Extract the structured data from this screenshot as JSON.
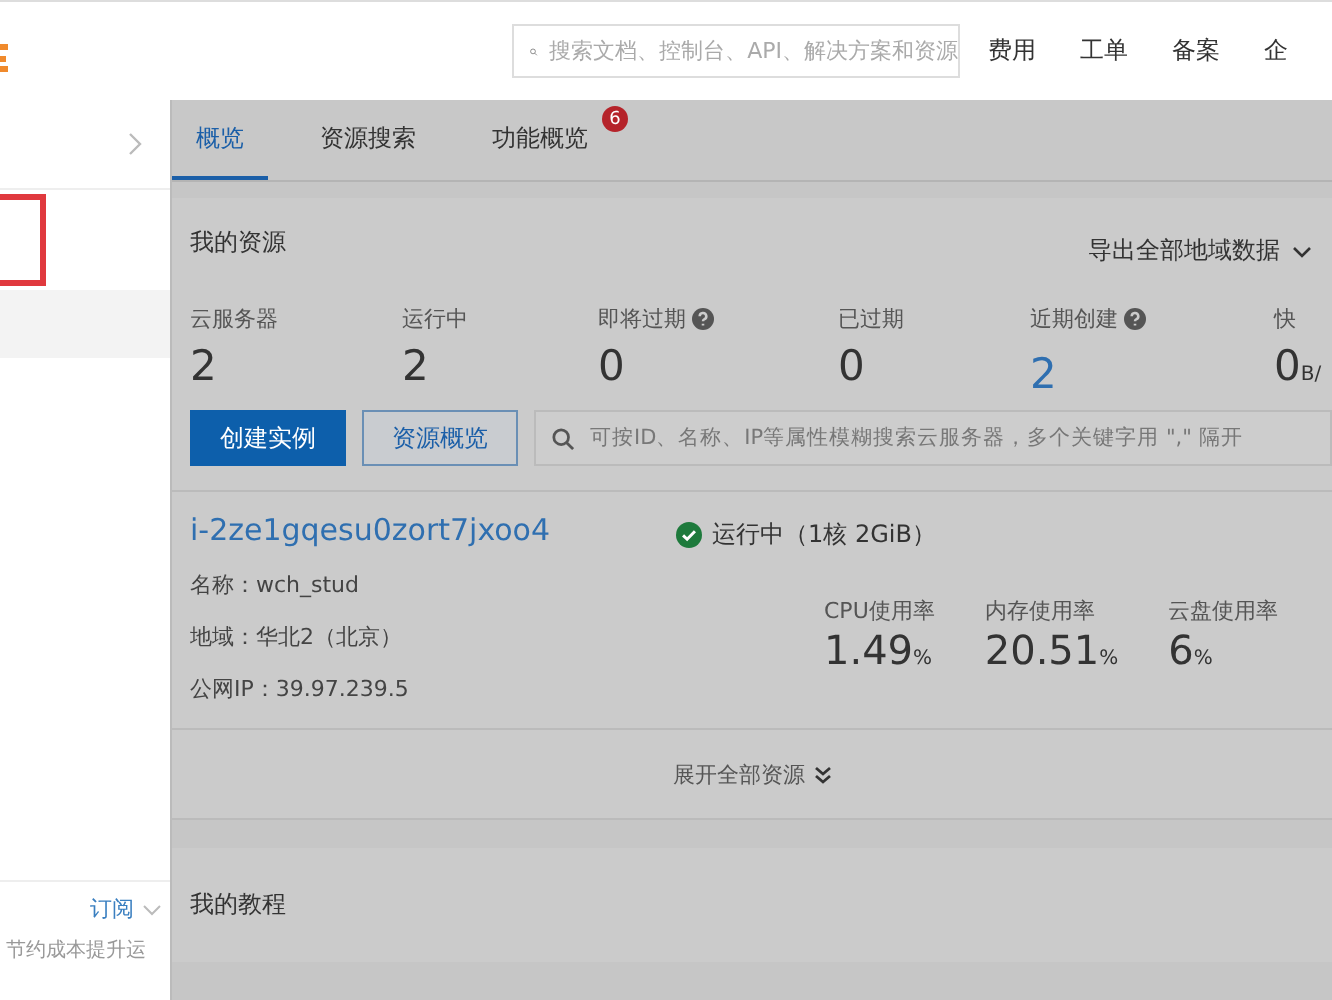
{
  "header": {
    "search": {
      "placeholder": "搜索文档、控制台、API、解决方案和资源"
    },
    "nav": [
      "费用",
      "工单",
      "备案",
      "企"
    ]
  },
  "sidebar": {
    "footer_link": "订阅",
    "footer_text": "节约成本提升运"
  },
  "tabs": [
    {
      "label": "概览",
      "selected": true
    },
    {
      "label": "资源搜索",
      "selected": false
    },
    {
      "label": "功能概览",
      "selected": false,
      "badge": "6"
    }
  ],
  "resources": {
    "title": "我的资源",
    "export": "导出全部地域数据",
    "stats": [
      {
        "label": "云服务器",
        "value": "2",
        "help": false,
        "link": false
      },
      {
        "label": "运行中",
        "value": "2",
        "help": false,
        "link": false
      },
      {
        "label": "即将过期",
        "value": "0",
        "help": true,
        "link": false
      },
      {
        "label": "已过期",
        "value": "0",
        "help": false,
        "link": false
      },
      {
        "label": "近期创建",
        "value": "2",
        "help": true,
        "link": true
      },
      {
        "label": "快",
        "value": "0",
        "help": false,
        "link": false,
        "unit": "B/"
      }
    ],
    "buttons": [
      {
        "label": "创建实例",
        "kind": "primary"
      },
      {
        "label": "资源概览",
        "kind": "outline"
      }
    ],
    "search": {
      "placeholder": "可按ID、名称、IP等属性模糊搜索云服务器，多个关键字用 \",\" 隔开"
    }
  },
  "instance": {
    "id": "i-2ze1gqesu0zort7jxoo4",
    "status": "运行中（1核 2GiB）",
    "fields": [
      "名称：wch_stud",
      "地域：华北2（北京）",
      "公网IP：39.97.239.5"
    ],
    "metrics": [
      {
        "label": "CPU使用率",
        "value": "1.49",
        "unit": "%"
      },
      {
        "label": "内存使用率",
        "value": "20.51",
        "unit": "%"
      },
      {
        "label": "云盘使用率",
        "value": "6",
        "unit": "%"
      }
    ]
  },
  "expand": "展开全部资源",
  "tutorial": {
    "title": "我的教程"
  }
}
